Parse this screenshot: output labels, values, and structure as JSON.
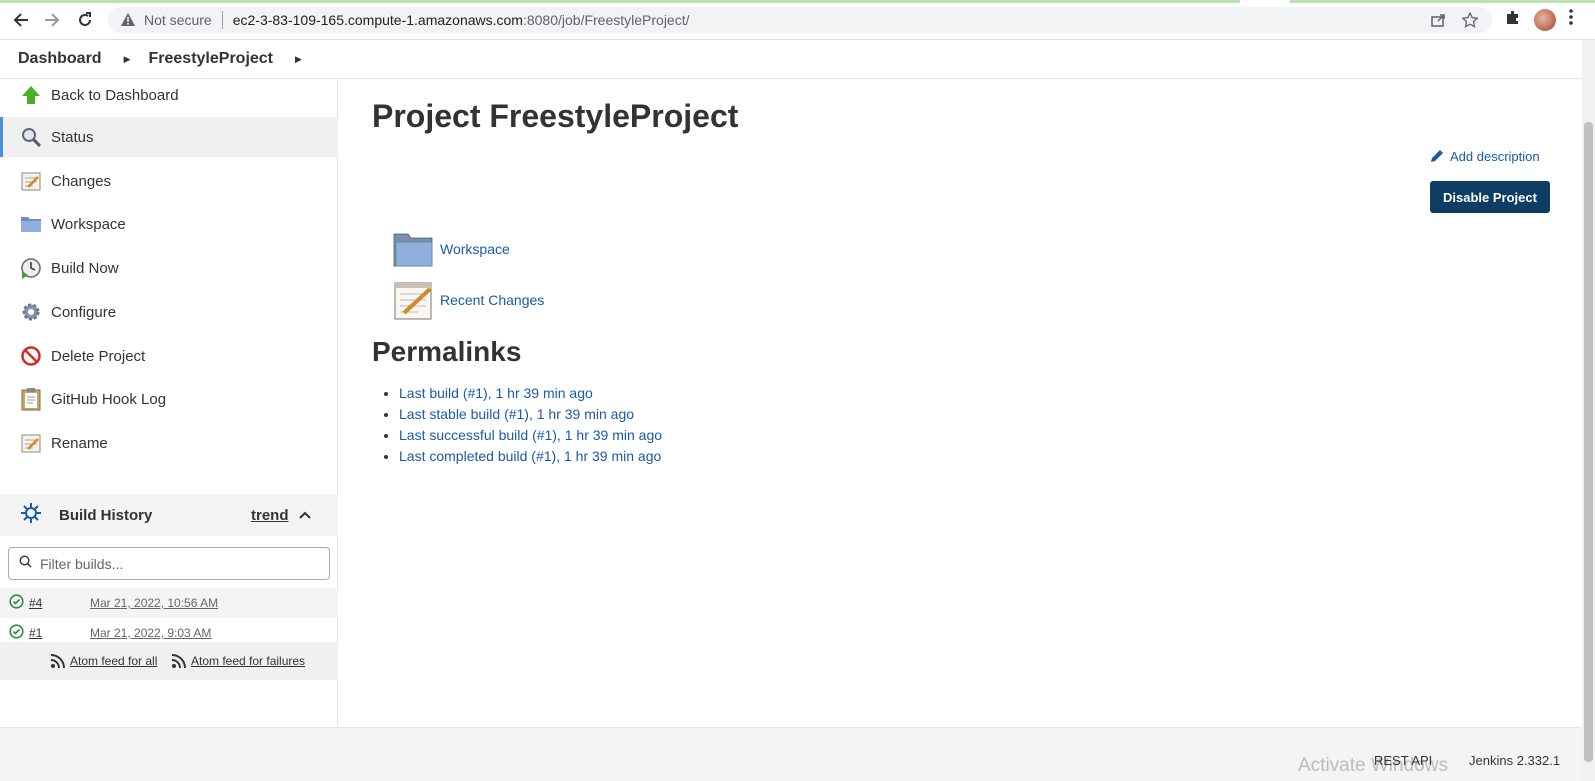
{
  "browser": {
    "security_label": "Not secure",
    "url_host": "ec2-3-83-109-165.compute-1.amazonaws.com",
    "url_rest": ":8080/job/FreestyleProject/"
  },
  "breadcrumb": {
    "items": [
      "Dashboard",
      "FreestyleProject"
    ]
  },
  "sidebar": {
    "items": [
      {
        "label": "Back to Dashboard",
        "icon": "arrow-up-icon"
      },
      {
        "label": "Status",
        "icon": "magnifier-icon"
      },
      {
        "label": "Changes",
        "icon": "notepad-icon"
      },
      {
        "label": "Workspace",
        "icon": "folder-icon"
      },
      {
        "label": "Build Now",
        "icon": "clock-play-icon"
      },
      {
        "label": "Configure",
        "icon": "gear-icon"
      },
      {
        "label": "Delete Project",
        "icon": "no-entry-icon"
      },
      {
        "label": "GitHub Hook Log",
        "icon": "clipboard-icon"
      },
      {
        "label": "Rename",
        "icon": "notepad-icon"
      }
    ],
    "active_index": 1
  },
  "build_history": {
    "title": "Build History",
    "trend_label": "trend",
    "filter_placeholder": "Filter builds...",
    "builds": [
      {
        "number": "#4",
        "date": "Mar 21, 2022, 10:56 AM",
        "status": "success"
      },
      {
        "number": "#1",
        "date": "Mar 21, 2022, 9:03 AM",
        "status": "success"
      }
    ],
    "atom_all": "Atom feed for all",
    "atom_failures": "Atom feed for failures"
  },
  "main": {
    "title": "Project FreestyleProject",
    "add_description": "Add description",
    "disable_button": "Disable Project",
    "links": [
      {
        "label": "Workspace",
        "icon": "folder-icon"
      },
      {
        "label": "Recent Changes",
        "icon": "notepad-icon"
      }
    ],
    "permalinks_title": "Permalinks",
    "permalinks": [
      "Last build (#1), 1 hr 39 min ago",
      "Last stable build (#1), 1 hr 39 min ago",
      "Last successful build (#1), 1 hr 39 min ago",
      "Last completed build (#1), 1 hr 39 min ago"
    ]
  },
  "footer": {
    "rest_api": "REST API",
    "version": "Jenkins 2.332.1",
    "watermark": "Activate Windows"
  },
  "colors": {
    "accent": "#1a5aa8",
    "button_bg": "#0d3d63",
    "success": "#2e8b3a"
  }
}
